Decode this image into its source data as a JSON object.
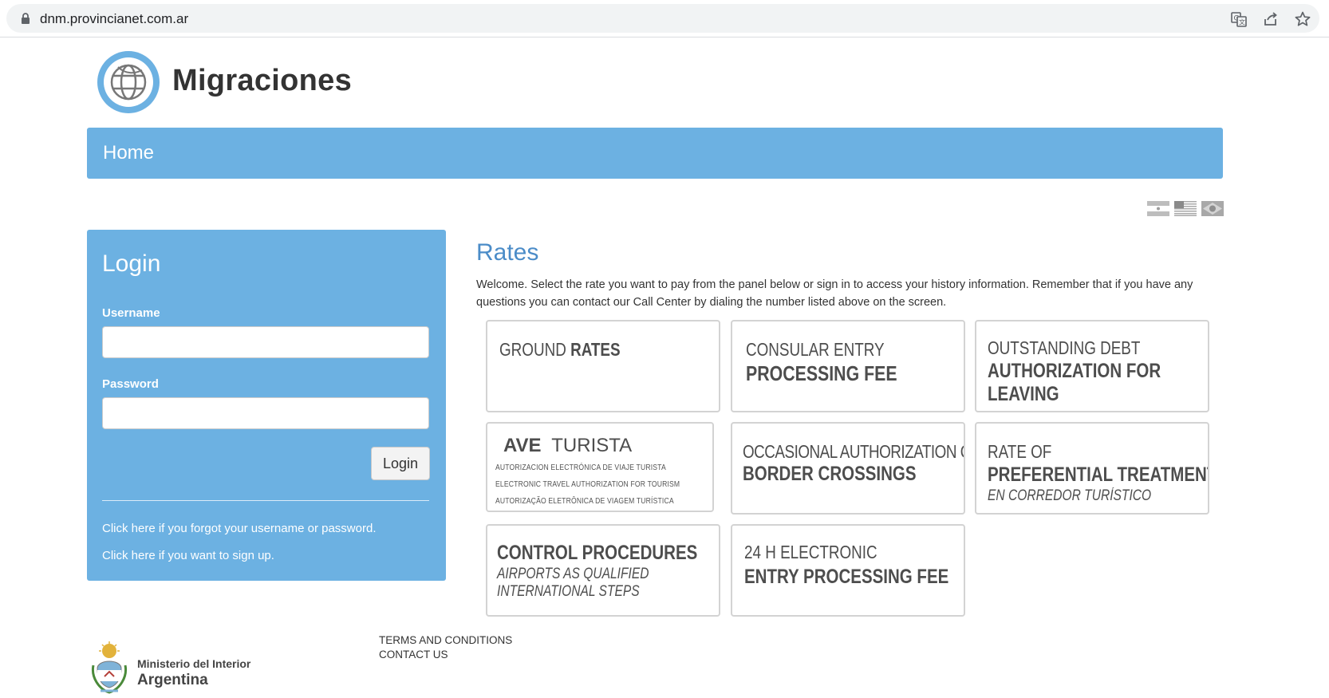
{
  "browser": {
    "url": "dnm.provincianet.com.ar",
    "icons": [
      "lock-icon",
      "translate-icon",
      "share-icon",
      "star-icon"
    ]
  },
  "header": {
    "logo_text": "Migraciones",
    "logo_icon": "globe-icon"
  },
  "nav": {
    "home_label": "Home"
  },
  "languages": [
    "argentina-flag-icon",
    "usa-flag-icon",
    "brazil-flag-icon"
  ],
  "login": {
    "title": "Login",
    "username_label": "Username",
    "username_value": "",
    "password_label": "Password",
    "password_value": "",
    "button_label": "Login",
    "forgot_link": "Click here if you forgot your username or password.",
    "signup_link": "Click here if you want to sign up."
  },
  "rates": {
    "title": "Rates",
    "welcome": "Welcome. Select the rate you want to pay from the panel below or sign in to access your history information. Remember that if you have any questions you can contact our Call Center by dialing the number listed above on the screen.",
    "cards": {
      "ground": {
        "light": "GROUND",
        "bold": "RATES"
      },
      "consular": {
        "line1": "CONSULAR ENTRY",
        "line2": "PROCESSING FEE"
      },
      "debt": {
        "line1": "OUTSTANDING DEBT",
        "line2": "AUTHORIZATION FOR",
        "line3": "LEAVING"
      },
      "ave": {
        "bold": "AVE",
        "light": "TURISTA",
        "sub1": "AUTORIZACION ELECTRÓNICA DE VIAJE TURISTA",
        "sub2": "ELECTRONIC TRAVEL AUTHORIZATION FOR TOURISM",
        "sub3": "AUTORIZAÇÃO ELETRÔNICA DE VIAGEM TURÍSTICA"
      },
      "occasional": {
        "line1": "OCCASIONAL AUTHORIZATION OF",
        "line2": "BORDER CROSSINGS"
      },
      "preferential": {
        "line1": "RATE OF",
        "line2": "PREFERENTIAL TREATMENT",
        "line3": "EN CORREDOR TURÍSTICO"
      },
      "control": {
        "line1": "CONTROL PROCEDURES",
        "line2": "AIRPORTS AS QUALIFIED",
        "line3": "INTERNATIONAL STEPS"
      },
      "electronic24": {
        "line1": "24 H ELECTRONIC",
        "line2": "ENTRY PROCESSING FEE"
      }
    }
  },
  "footer": {
    "ministry_line1": "Ministerio del Interior",
    "ministry_line2": "Argentina",
    "terms_link": "TERMS AND CONDITIONS",
    "contact_link": "CONTACT US"
  },
  "colors": {
    "accent": "#6cb1e2",
    "title_blue": "#4b8cc8"
  }
}
